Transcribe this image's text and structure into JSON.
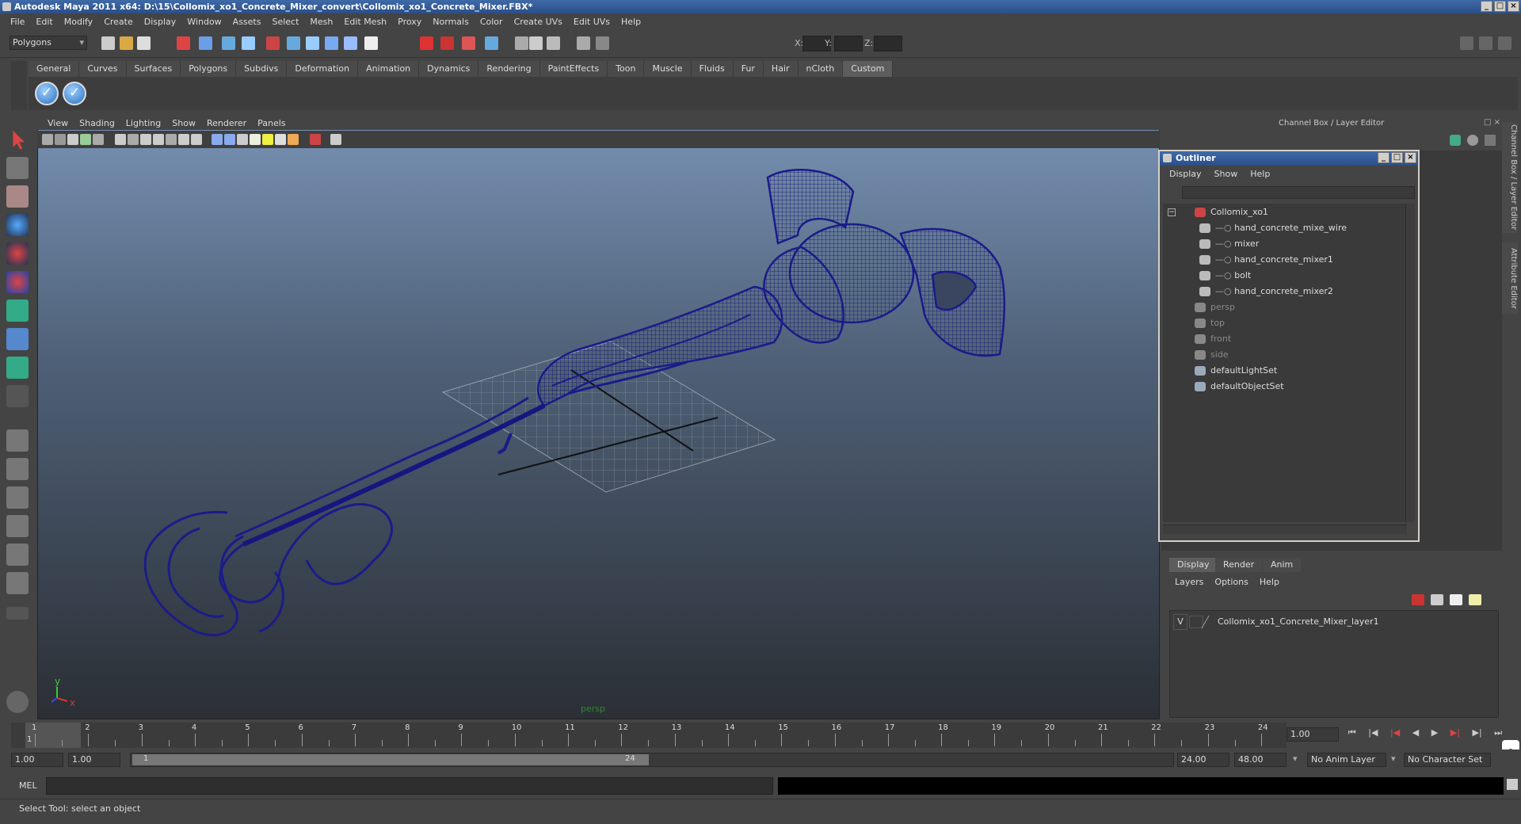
{
  "window": {
    "title": "Autodesk Maya 2011 x64: D:\\15\\Collomix_xo1_Concrete_Mixer_convert\\Collomix_xo1_Concrete_Mixer.FBX*"
  },
  "menubar": [
    "File",
    "Edit",
    "Modify",
    "Create",
    "Display",
    "Window",
    "Assets",
    "Select",
    "Mesh",
    "Edit Mesh",
    "Proxy",
    "Normals",
    "Color",
    "Create UVs",
    "Edit UVs",
    "Help"
  ],
  "status_line": {
    "menu_set": "Polygons",
    "x_label": "X:",
    "y_label": "Y:",
    "z_label": "Z:"
  },
  "shelf": {
    "tabs": [
      "General",
      "Curves",
      "Surfaces",
      "Polygons",
      "Subdivs",
      "Deformation",
      "Animation",
      "Dynamics",
      "Rendering",
      "PaintEffects",
      "Toon",
      "Muscle",
      "Fluids",
      "Fur",
      "Hair",
      "nCloth",
      "Custom"
    ],
    "active_tab": "Custom",
    "buttons": [
      "check-icon",
      "check-icon"
    ]
  },
  "viewport": {
    "menu": [
      "View",
      "Shading",
      "Lighting",
      "Show",
      "Renderer",
      "Panels"
    ],
    "camera_label": "persp",
    "axis_y": "y",
    "axis_x": "x",
    "wire_color": "#1b1b8a"
  },
  "right_panel": {
    "header": "Channel Box / Layer Editor",
    "side_tabs": [
      "Channel Box / Layer Editor",
      "Attribute Editor"
    ]
  },
  "outliner": {
    "title": "Outliner",
    "menu": [
      "Display",
      "Show",
      "Help"
    ],
    "items": [
      {
        "label": "Collomix_xo1",
        "level": 0,
        "dim": false,
        "icon": "transform-icon"
      },
      {
        "label": "hand_concrete_mixe_wire",
        "level": 1,
        "dim": false,
        "icon": "mesh-icon"
      },
      {
        "label": "mixer",
        "level": 1,
        "dim": false,
        "icon": "mesh-icon"
      },
      {
        "label": "hand_concrete_mixer1",
        "level": 1,
        "dim": false,
        "icon": "mesh-icon"
      },
      {
        "label": "bolt",
        "level": 1,
        "dim": false,
        "icon": "mesh-icon"
      },
      {
        "label": "hand_concrete_mixer2",
        "level": 1,
        "dim": false,
        "icon": "mesh-icon"
      },
      {
        "label": "persp",
        "level": 0,
        "dim": true,
        "icon": "camera-icon"
      },
      {
        "label": "top",
        "level": 0,
        "dim": true,
        "icon": "camera-icon"
      },
      {
        "label": "front",
        "level": 0,
        "dim": true,
        "icon": "camera-icon"
      },
      {
        "label": "side",
        "level": 0,
        "dim": true,
        "icon": "camera-icon"
      },
      {
        "label": "defaultLightSet",
        "level": 0,
        "dim": false,
        "icon": "set-icon"
      },
      {
        "label": "defaultObjectSet",
        "level": 0,
        "dim": false,
        "icon": "set-icon"
      }
    ]
  },
  "layer_editor": {
    "tabs": [
      "Display",
      "Render",
      "Anim"
    ],
    "active_tab": "Display",
    "menu": [
      "Layers",
      "Options",
      "Help"
    ],
    "layers": [
      {
        "visible": "V",
        "name": "Collomix_xo1_Concrete_Mixer_layer1"
      }
    ]
  },
  "timeline": {
    "ticks": [
      "1",
      "2",
      "3",
      "4",
      "5",
      "6",
      "7",
      "8",
      "9",
      "10",
      "11",
      "12",
      "13",
      "14",
      "15",
      "16",
      "17",
      "18",
      "19",
      "20",
      "21",
      "22",
      "23",
      "24"
    ],
    "current_frame": "1",
    "current_time_field": "1.00"
  },
  "range": {
    "start_time": "1.00",
    "playback_start": "1.00",
    "slider_start": "1",
    "slider_end": "24",
    "playback_end": "24.00",
    "end_time": "48.00",
    "anim_layer": "No Anim Layer",
    "character_set": "No Character Set"
  },
  "command_line": {
    "label": "MEL"
  },
  "help_line": "Select Tool: select an object"
}
